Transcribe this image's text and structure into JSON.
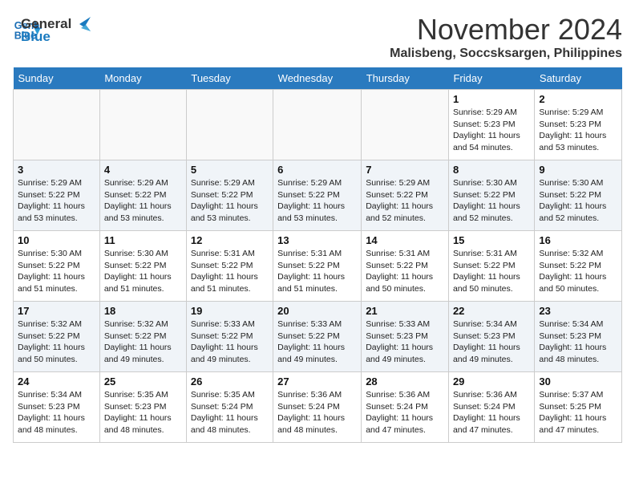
{
  "header": {
    "logo_line1": "General",
    "logo_line2": "Blue",
    "month": "November 2024",
    "location": "Malisbeng, Soccsksargen, Philippines"
  },
  "weekdays": [
    "Sunday",
    "Monday",
    "Tuesday",
    "Wednesday",
    "Thursday",
    "Friday",
    "Saturday"
  ],
  "weeks": [
    [
      {
        "day": "",
        "info": ""
      },
      {
        "day": "",
        "info": ""
      },
      {
        "day": "",
        "info": ""
      },
      {
        "day": "",
        "info": ""
      },
      {
        "day": "",
        "info": ""
      },
      {
        "day": "1",
        "info": "Sunrise: 5:29 AM\nSunset: 5:23 PM\nDaylight: 11 hours and 54 minutes."
      },
      {
        "day": "2",
        "info": "Sunrise: 5:29 AM\nSunset: 5:23 PM\nDaylight: 11 hours and 53 minutes."
      }
    ],
    [
      {
        "day": "3",
        "info": "Sunrise: 5:29 AM\nSunset: 5:22 PM\nDaylight: 11 hours and 53 minutes."
      },
      {
        "day": "4",
        "info": "Sunrise: 5:29 AM\nSunset: 5:22 PM\nDaylight: 11 hours and 53 minutes."
      },
      {
        "day": "5",
        "info": "Sunrise: 5:29 AM\nSunset: 5:22 PM\nDaylight: 11 hours and 53 minutes."
      },
      {
        "day": "6",
        "info": "Sunrise: 5:29 AM\nSunset: 5:22 PM\nDaylight: 11 hours and 53 minutes."
      },
      {
        "day": "7",
        "info": "Sunrise: 5:29 AM\nSunset: 5:22 PM\nDaylight: 11 hours and 52 minutes."
      },
      {
        "day": "8",
        "info": "Sunrise: 5:30 AM\nSunset: 5:22 PM\nDaylight: 11 hours and 52 minutes."
      },
      {
        "day": "9",
        "info": "Sunrise: 5:30 AM\nSunset: 5:22 PM\nDaylight: 11 hours and 52 minutes."
      }
    ],
    [
      {
        "day": "10",
        "info": "Sunrise: 5:30 AM\nSunset: 5:22 PM\nDaylight: 11 hours and 51 minutes."
      },
      {
        "day": "11",
        "info": "Sunrise: 5:30 AM\nSunset: 5:22 PM\nDaylight: 11 hours and 51 minutes."
      },
      {
        "day": "12",
        "info": "Sunrise: 5:31 AM\nSunset: 5:22 PM\nDaylight: 11 hours and 51 minutes."
      },
      {
        "day": "13",
        "info": "Sunrise: 5:31 AM\nSunset: 5:22 PM\nDaylight: 11 hours and 51 minutes."
      },
      {
        "day": "14",
        "info": "Sunrise: 5:31 AM\nSunset: 5:22 PM\nDaylight: 11 hours and 50 minutes."
      },
      {
        "day": "15",
        "info": "Sunrise: 5:31 AM\nSunset: 5:22 PM\nDaylight: 11 hours and 50 minutes."
      },
      {
        "day": "16",
        "info": "Sunrise: 5:32 AM\nSunset: 5:22 PM\nDaylight: 11 hours and 50 minutes."
      }
    ],
    [
      {
        "day": "17",
        "info": "Sunrise: 5:32 AM\nSunset: 5:22 PM\nDaylight: 11 hours and 50 minutes."
      },
      {
        "day": "18",
        "info": "Sunrise: 5:32 AM\nSunset: 5:22 PM\nDaylight: 11 hours and 49 minutes."
      },
      {
        "day": "19",
        "info": "Sunrise: 5:33 AM\nSunset: 5:22 PM\nDaylight: 11 hours and 49 minutes."
      },
      {
        "day": "20",
        "info": "Sunrise: 5:33 AM\nSunset: 5:22 PM\nDaylight: 11 hours and 49 minutes."
      },
      {
        "day": "21",
        "info": "Sunrise: 5:33 AM\nSunset: 5:23 PM\nDaylight: 11 hours and 49 minutes."
      },
      {
        "day": "22",
        "info": "Sunrise: 5:34 AM\nSunset: 5:23 PM\nDaylight: 11 hours and 49 minutes."
      },
      {
        "day": "23",
        "info": "Sunrise: 5:34 AM\nSunset: 5:23 PM\nDaylight: 11 hours and 48 minutes."
      }
    ],
    [
      {
        "day": "24",
        "info": "Sunrise: 5:34 AM\nSunset: 5:23 PM\nDaylight: 11 hours and 48 minutes."
      },
      {
        "day": "25",
        "info": "Sunrise: 5:35 AM\nSunset: 5:23 PM\nDaylight: 11 hours and 48 minutes."
      },
      {
        "day": "26",
        "info": "Sunrise: 5:35 AM\nSunset: 5:24 PM\nDaylight: 11 hours and 48 minutes."
      },
      {
        "day": "27",
        "info": "Sunrise: 5:36 AM\nSunset: 5:24 PM\nDaylight: 11 hours and 48 minutes."
      },
      {
        "day": "28",
        "info": "Sunrise: 5:36 AM\nSunset: 5:24 PM\nDaylight: 11 hours and 47 minutes."
      },
      {
        "day": "29",
        "info": "Sunrise: 5:36 AM\nSunset: 5:24 PM\nDaylight: 11 hours and 47 minutes."
      },
      {
        "day": "30",
        "info": "Sunrise: 5:37 AM\nSunset: 5:25 PM\nDaylight: 11 hours and 47 minutes."
      }
    ]
  ]
}
